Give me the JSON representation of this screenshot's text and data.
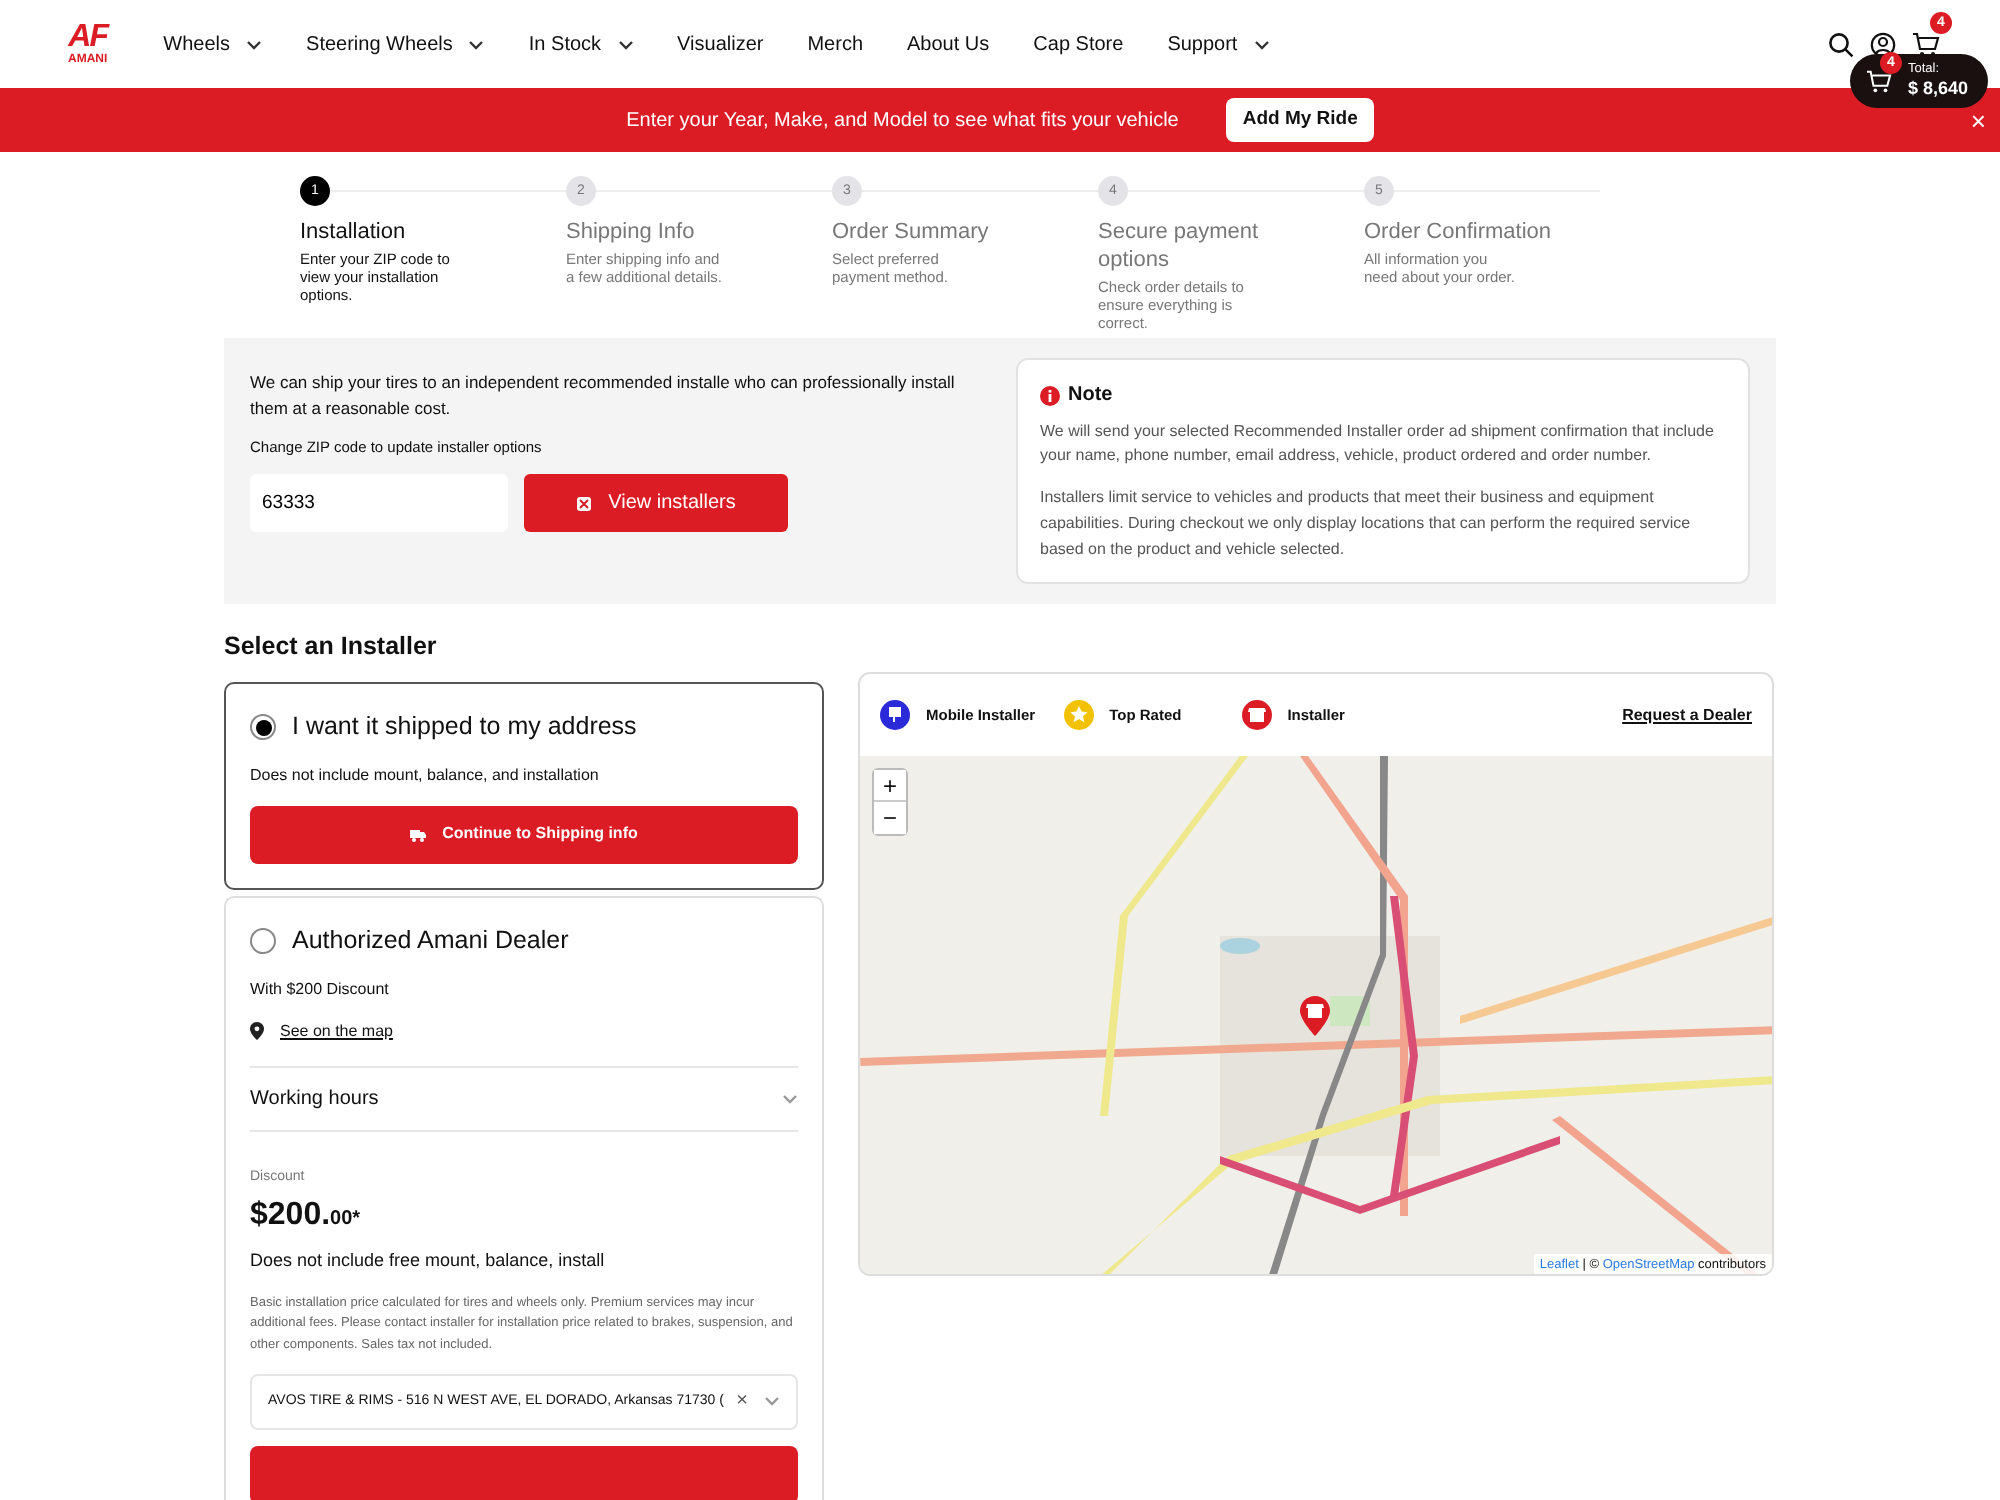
{
  "header": {
    "logo": {
      "mark": "AF",
      "name": "AMANI"
    },
    "nav": [
      {
        "label": "Wheels",
        "dropdown": true
      },
      {
        "label": "Steering Wheels",
        "dropdown": true
      },
      {
        "label": "In Stock",
        "dropdown": true
      },
      {
        "label": "Visualizer",
        "dropdown": false
      },
      {
        "label": "Merch",
        "dropdown": false
      },
      {
        "label": "About Us",
        "dropdown": false
      },
      {
        "label": "Cap Store",
        "dropdown": false
      },
      {
        "label": "Support",
        "dropdown": true
      }
    ],
    "cart_count": "4"
  },
  "banner": {
    "text": "Enter your Year, Make, and Model to see what fits your vehicle",
    "button": "Add My Ride",
    "close": "×"
  },
  "cart_summary": {
    "count": "4",
    "label": "Total:",
    "total": "$ 8,640"
  },
  "steps": [
    {
      "number": "1",
      "title": "Installation",
      "description": "Enter your ZIP code to view your installation options.",
      "selected": true
    },
    {
      "number": "2",
      "title": "Shipping Info",
      "description": "Enter shipping info and a few additional details.",
      "selected": false
    },
    {
      "number": "3",
      "title": "Order Summary",
      "description": "Select preferred payment method.",
      "selected": false
    },
    {
      "number": "4",
      "title": "Secure payment options",
      "description": "Check order details to ensure everything is correct.",
      "selected": false
    },
    {
      "number": "5",
      "title": "Order Confirmation",
      "description": "All information you need about your order.",
      "selected": false
    }
  ],
  "zip_panel": {
    "intro": "We can ship your tires to an independent recommended installe who can professionally install them at a reasonable cost.",
    "label": "Change ZIP code to update installer options",
    "zip": "63333",
    "button": "View installers",
    "note": {
      "title": "Note",
      "paragraphs": [
        "We will send your selected Recommended Installer order ad shipment confirmation that include your name, phone number, email address, vehicle, product ordered and order number.",
        "Installers limit service to vehicles and products that meet their business and equipment capabilities. During checkout we only display locations that can perform the required service based on the product and vehicle selected."
      ]
    }
  },
  "installer": {
    "heading": "Select an Installer",
    "options": [
      {
        "kind": "ship",
        "title": "I want it shipped to my address",
        "selected": true,
        "subtitle": "Does not include mount, balance, and installation",
        "button": "Continue to Shipping info"
      },
      {
        "kind": "dealer",
        "title": "Authorized Amani Dealer",
        "selected": false,
        "subtitle": "With $200 Discount",
        "map_link": "See on the map",
        "hours": "Working hours",
        "hours_expanded": false,
        "discount_label": "Discount",
        "price": "$200.",
        "cents": "00*",
        "price_note": "Does not include free mount, balance, install",
        "disclaimer": "Basic installation price calculated for tires and wheels only. Premium services may incur additional fees. Please contact installer for installation price related to brakes, suspension, and other components. Sales tax not included.",
        "dealer_select": "AVOS TIRE & RIMS - 516 N WEST AVE, EL DORADO, Arkansas 71730 (",
        "clear": "×"
      }
    ]
  },
  "map": {
    "legend": [
      {
        "label": "Mobile Installer",
        "color": "#2a2ad8"
      },
      {
        "label": "Top Rated",
        "color": "#f2c200"
      },
      {
        "label": "Installer",
        "color": "#dc1c24"
      }
    ],
    "request_link": "Request a Dealer",
    "zoom_in": "+",
    "zoom_out": "−",
    "attribution": {
      "leaflet": "Leaflet",
      "sep": "| ©",
      "osm": "OpenStreetMap",
      "suffix": "contributors"
    }
  }
}
